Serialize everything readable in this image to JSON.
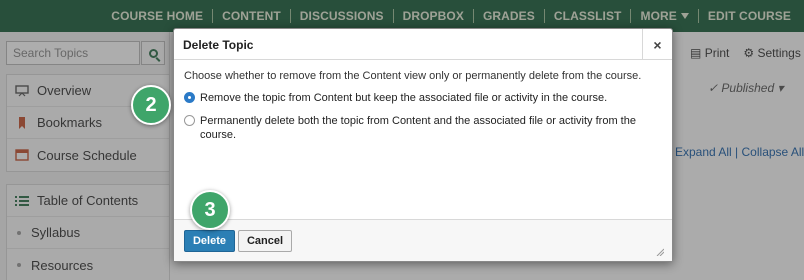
{
  "topnav": {
    "items": [
      "COURSE HOME",
      "CONTENT",
      "DISCUSSIONS",
      "DROPBOX",
      "GRADES",
      "CLASSLIST",
      "MORE",
      "EDIT COURSE"
    ]
  },
  "sidebar": {
    "search_placeholder": "Search Topics",
    "group1": [
      "Overview",
      "Bookmarks",
      "Course Schedule"
    ],
    "group2_title": "Table of Contents",
    "group2_items": [
      "Syllabus",
      "Resources"
    ]
  },
  "toolbar": {
    "print": "Print",
    "settings": "Settings",
    "published": "Published",
    "expand_all": "Expand All",
    "collapse_all": "Collapse All"
  },
  "dialog": {
    "title": "Delete Topic",
    "close_glyph": "×",
    "prompt": "Choose whether to remove from the Content view only or permanently delete from the course.",
    "options": [
      {
        "label": "Remove the topic from Content but keep the associated file or activity in the course.",
        "checked": true
      },
      {
        "label": "Permanently delete both the topic from Content and the associated file or activity from the course.",
        "checked": false
      }
    ],
    "delete_label": "Delete",
    "cancel_label": "Cancel"
  },
  "steps": [
    "2",
    "3"
  ],
  "colors": {
    "nav_bg": "#1b5e3b",
    "nav_text": "#e6ecd8",
    "accent_blue": "#2b7fb5",
    "step_green": "#3fa56a"
  },
  "icons": {
    "search": "search-icon",
    "overview": "presentation-icon",
    "bookmarks": "bookmark-icon",
    "schedule": "calendar-icon",
    "toc": "list-icon",
    "print": "printer-icon",
    "settings": "gear-icon",
    "published": "checkmark-icon"
  }
}
